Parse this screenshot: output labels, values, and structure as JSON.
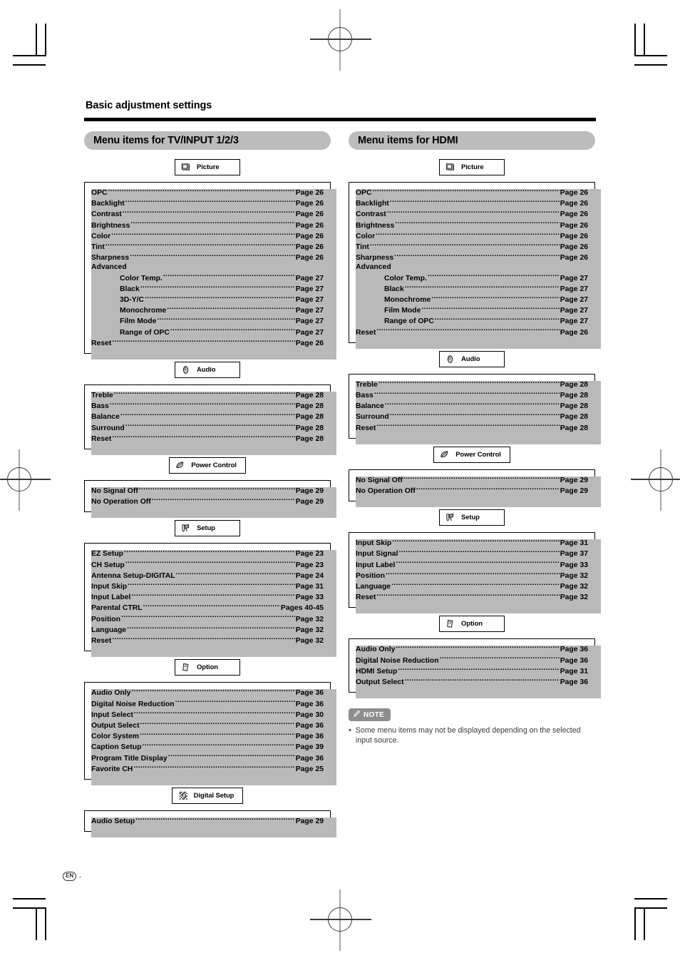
{
  "document": {
    "page_title": "Basic adjustment settings",
    "footer_language_badge": "EN",
    "footer_dash": "-"
  },
  "columns": [
    {
      "band_label": "Menu items for TV/INPUT 1/2/3",
      "sections": [
        {
          "button_label": "Picture",
          "icon": "picture-monitor-icon",
          "items": [
            {
              "label": "OPC",
              "page": "Page 26",
              "indent": false
            },
            {
              "label": "Backlight",
              "page": "Page 26",
              "indent": false
            },
            {
              "label": "Contrast",
              "page": "Page 26",
              "indent": false
            },
            {
              "label": "Brightness",
              "page": "Page 26",
              "indent": false
            },
            {
              "label": "Color",
              "page": "Page 26",
              "indent": false
            },
            {
              "label": "Tint",
              "page": "Page 26",
              "indent": false
            },
            {
              "label": "Sharpness",
              "page": "Page 26",
              "indent": false
            },
            {
              "label": "Advanced",
              "page": "",
              "indent": false,
              "no_dots": true
            },
            {
              "label": "Color Temp.",
              "page": "Page 27",
              "indent": true
            },
            {
              "label": "Black",
              "page": "Page 27",
              "indent": true
            },
            {
              "label": "3D-Y/C",
              "page": "Page 27",
              "indent": true
            },
            {
              "label": "Monochrome",
              "page": "Page 27",
              "indent": true
            },
            {
              "label": "Film Mode",
              "page": "Page 27",
              "indent": true
            },
            {
              "label": "Range of OPC",
              "page": "Page 27",
              "indent": true
            },
            {
              "label": "Reset",
              "page": "Page 26",
              "indent": false
            }
          ]
        },
        {
          "button_label": "Audio",
          "icon": "audio-speaker-icon",
          "items": [
            {
              "label": "Treble",
              "page": "Page 28",
              "indent": false
            },
            {
              "label": "Bass",
              "page": "Page 28",
              "indent": false
            },
            {
              "label": "Balance",
              "page": "Page 28",
              "indent": false
            },
            {
              "label": "Surround",
              "page": "Page 28",
              "indent": false
            },
            {
              "label": "Reset",
              "page": "Page 28",
              "indent": false
            }
          ]
        },
        {
          "button_label": "Power Control",
          "icon": "power-leaf-icon",
          "items": [
            {
              "label": "No Signal Off",
              "page": "Page 29",
              "indent": false
            },
            {
              "label": "No Operation Off",
              "page": "Page 29",
              "indent": false
            }
          ]
        },
        {
          "button_label": "Setup",
          "icon": "setup-tools-icon",
          "items": [
            {
              "label": "EZ Setup",
              "page": "Page 23",
              "indent": false
            },
            {
              "label": "CH Setup",
              "page": "Page 23",
              "indent": false
            },
            {
              "label": "Antenna Setup-DIGITAL",
              "page": "Page 24",
              "indent": false
            },
            {
              "label": "Input Skip",
              "page": "Page 31",
              "indent": false
            },
            {
              "label": "Input Label",
              "page": "Page 33",
              "indent": false
            },
            {
              "label": "Parental CTRL",
              "page": "Pages 40-45",
              "indent": false
            },
            {
              "label": "Position",
              "page": "Page 32",
              "indent": false
            },
            {
              "label": "Language",
              "page": "Page 32",
              "indent": false
            },
            {
              "label": "Reset",
              "page": "Page 32",
              "indent": false
            }
          ]
        },
        {
          "button_label": "Option",
          "icon": "option-card-icon",
          "items": [
            {
              "label": "Audio Only",
              "page": "Page 36",
              "indent": false
            },
            {
              "label": "Digital Noise Reduction",
              "page": "Page 36",
              "indent": false
            },
            {
              "label": "Input Select",
              "page": "Page 30",
              "indent": false
            },
            {
              "label": "Output Select",
              "page": "Page 36",
              "indent": false
            },
            {
              "label": "Color System",
              "page": "Page 36",
              "indent": false
            },
            {
              "label": "Caption Setup",
              "page": "Page 39",
              "indent": false
            },
            {
              "label": "Program Title Display",
              "page": "Page 36",
              "indent": false
            },
            {
              "label": "Favorite CH",
              "page": "Page 25",
              "indent": false
            }
          ]
        },
        {
          "button_label": "Digital Setup",
          "icon": "digital-setup-grid-icon",
          "items": [
            {
              "label": "Audio Setup",
              "page": "Page 29",
              "indent": false
            }
          ]
        }
      ]
    },
    {
      "band_label": "Menu items for HDMI",
      "sections": [
        {
          "button_label": "Picture",
          "icon": "picture-monitor-icon",
          "items": [
            {
              "label": "OPC",
              "page": "Page 26",
              "indent": false
            },
            {
              "label": "Backlight",
              "page": "Page 26",
              "indent": false
            },
            {
              "label": "Contrast",
              "page": "Page 26",
              "indent": false
            },
            {
              "label": "Brightness",
              "page": "Page 26",
              "indent": false
            },
            {
              "label": "Color",
              "page": "Page 26",
              "indent": false
            },
            {
              "label": "Tint",
              "page": "Page 26",
              "indent": false
            },
            {
              "label": "Sharpness",
              "page": "Page 26",
              "indent": false
            },
            {
              "label": "Advanced",
              "page": "",
              "indent": false,
              "no_dots": true
            },
            {
              "label": "Color Temp.",
              "page": "Page 27",
              "indent": true
            },
            {
              "label": "Black",
              "page": "Page 27",
              "indent": true
            },
            {
              "label": "Monochrome",
              "page": "Page 27",
              "indent": true
            },
            {
              "label": "Film Mode",
              "page": "Page 27",
              "indent": true
            },
            {
              "label": "Range of OPC",
              "page": "Page 27",
              "indent": true
            },
            {
              "label": "Reset",
              "page": "Page 26",
              "indent": false
            }
          ]
        },
        {
          "button_label": "Audio",
          "icon": "audio-speaker-icon",
          "items": [
            {
              "label": "Treble",
              "page": "Page 28",
              "indent": false
            },
            {
              "label": "Bass",
              "page": "Page 28",
              "indent": false
            },
            {
              "label": "Balance",
              "page": "Page 28",
              "indent": false
            },
            {
              "label": "Surround",
              "page": "Page 28",
              "indent": false
            },
            {
              "label": "Reset",
              "page": "Page 28",
              "indent": false
            }
          ]
        },
        {
          "button_label": "Power Control",
          "icon": "power-leaf-icon",
          "items": [
            {
              "label": "No Signal Off",
              "page": "Page 29",
              "indent": false
            },
            {
              "label": "No Operation Off",
              "page": "Page 29",
              "indent": false
            }
          ]
        },
        {
          "button_label": "Setup",
          "icon": "setup-tools-icon",
          "items": [
            {
              "label": "Input Skip",
              "page": "Page 31",
              "indent": false
            },
            {
              "label": "Input Signal",
              "page": "Page 37",
              "indent": false
            },
            {
              "label": "Input Label",
              "page": "Page 33",
              "indent": false
            },
            {
              "label": "Position",
              "page": "Page 32",
              "indent": false
            },
            {
              "label": "Language",
              "page": "Page 32",
              "indent": false
            },
            {
              "label": "Reset",
              "page": "Page 32",
              "indent": false
            }
          ]
        },
        {
          "button_label": "Option",
          "icon": "option-card-icon",
          "items": [
            {
              "label": "Audio Only",
              "page": "Page 36",
              "indent": false
            },
            {
              "label": "Digital Noise Reduction",
              "page": "Page 36",
              "indent": false
            },
            {
              "label": "HDMI Setup",
              "page": "Page 31",
              "indent": false
            },
            {
              "label": "Output Select",
              "page": "Page 36",
              "indent": false
            }
          ]
        }
      ],
      "note": {
        "badge_label": "NOTE",
        "badge_icon": "pencil-note-icon",
        "bullet": "•",
        "text": "Some menu items may not be displayed depending on the selected input source."
      }
    }
  ],
  "colors": {
    "band_gray": "#bcbcbc",
    "shadow_gray": "#b9b9b9",
    "note_badge_gray": "#8d8d8d",
    "rule_black": "#000000"
  }
}
